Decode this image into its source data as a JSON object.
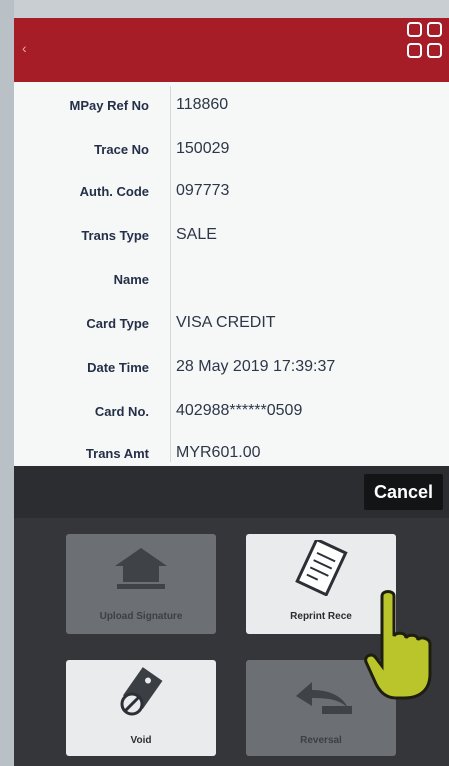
{
  "header": {
    "back_icon": "chevron-left-icon",
    "menu_icon": "grid-menu-icon"
  },
  "transaction": [
    {
      "label": "MPay Ref No",
      "value": "118860"
    },
    {
      "label": "Trace No",
      "value": "150029"
    },
    {
      "label": "Auth. Code",
      "value": "097773"
    },
    {
      "label": "Trans Type",
      "value": "SALE"
    },
    {
      "label": "Name",
      "value": ""
    },
    {
      "label": "Card Type",
      "value": "VISA CREDIT"
    },
    {
      "label": "Date Time",
      "value": "28 May 2019 17:39:37"
    },
    {
      "label": "Card No.",
      "value": "402988******0509"
    },
    {
      "label": "Trans Amt",
      "value": "MYR601.00"
    }
  ],
  "actions": {
    "cancel_label": "Cancel",
    "upload_signature": "Upload Signature",
    "reprint_receipt": "Reprint Rece",
    "void": "Void",
    "reversal": "Reversal"
  },
  "colors": {
    "header": "#a61d27",
    "panel": "#343639"
  }
}
